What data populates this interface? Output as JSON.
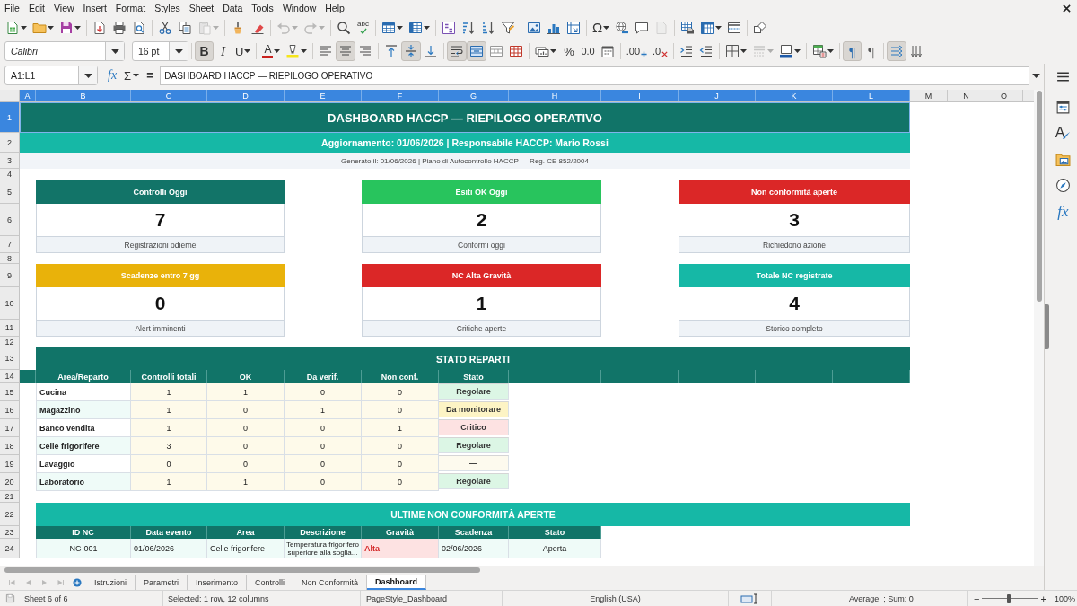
{
  "menu": [
    "File",
    "Edit",
    "View",
    "Insert",
    "Format",
    "Styles",
    "Sheet",
    "Data",
    "Tools",
    "Window",
    "Help"
  ],
  "standard_toolbar": [
    [
      {
        "kind": "new",
        "on": false,
        "disabled": false,
        "dropdown": true
      },
      {
        "kind": "open",
        "on": false,
        "disabled": false,
        "dropdown": true
      },
      {
        "kind": "save",
        "on": false,
        "disabled": false,
        "dropdown": true
      }
    ],
    [
      {
        "kind": "export-pdf",
        "on": false,
        "disabled": false
      },
      {
        "kind": "print",
        "on": false,
        "disabled": false
      },
      {
        "kind": "print-preview",
        "on": false,
        "disabled": false
      }
    ],
    [
      {
        "kind": "cut",
        "on": false,
        "disabled": false
      },
      {
        "kind": "copy",
        "on": false,
        "disabled": false
      },
      {
        "kind": "paste",
        "on": false,
        "disabled": true,
        "dropdown": true
      }
    ],
    [
      {
        "kind": "clone-format",
        "on": false,
        "disabled": false
      },
      {
        "kind": "clear-format",
        "on": false,
        "disabled": false
      }
    ],
    [
      {
        "kind": "undo",
        "on": false,
        "disabled": true,
        "dropdown": true
      },
      {
        "kind": "redo",
        "on": false,
        "disabled": true,
        "dropdown": true
      }
    ],
    [
      {
        "kind": "find-replace",
        "on": false,
        "disabled": false
      },
      {
        "kind": "spelling",
        "label": "abc",
        "on": false,
        "disabled": false
      }
    ],
    [
      {
        "kind": "insert-rows",
        "on": false,
        "disabled": false,
        "dropdown": true
      },
      {
        "kind": "insert-columns",
        "on": false,
        "disabled": false,
        "dropdown": true
      }
    ],
    [
      {
        "kind": "sort",
        "on": false,
        "disabled": false
      },
      {
        "kind": "sort-ascending",
        "on": false,
        "disabled": false
      },
      {
        "kind": "sort-descending",
        "on": false,
        "disabled": false
      },
      {
        "kind": "autofilter",
        "on": false,
        "disabled": false
      }
    ],
    [
      {
        "kind": "image",
        "on": false,
        "disabled": false
      },
      {
        "kind": "chart",
        "on": false,
        "disabled": false
      },
      {
        "kind": "pivot-table",
        "on": false,
        "disabled": false
      }
    ],
    [
      {
        "kind": "special-character",
        "label": "Ω",
        "on": false,
        "disabled": false,
        "dropdown": true
      },
      {
        "kind": "hyperlink",
        "on": false,
        "disabled": false
      },
      {
        "kind": "comment",
        "on": false,
        "disabled": false
      },
      {
        "kind": "header-footer",
        "on": false,
        "disabled": true
      }
    ],
    [
      {
        "kind": "print-range",
        "on": false,
        "disabled": false
      },
      {
        "kind": "freeze",
        "on": false,
        "disabled": false,
        "dropdown": true
      },
      {
        "kind": "split-window",
        "on": false,
        "disabled": false
      }
    ],
    [
      {
        "kind": "shapes",
        "on": false,
        "disabled": false
      }
    ]
  ],
  "formatting_toolbar": {
    "font_name": "Calibri",
    "font_size": "16 pt",
    "groups": [
      [
        {
          "kind": "bold",
          "label": "B",
          "on": true,
          "disabled": false
        },
        {
          "kind": "italic",
          "label": "I",
          "on": false,
          "disabled": false
        },
        {
          "kind": "underline",
          "label": "U",
          "on": false,
          "disabled": false,
          "dropdown": true
        }
      ],
      [
        {
          "kind": "font-color",
          "label": "A",
          "on": false,
          "disabled": false,
          "dropdown": true
        },
        {
          "kind": "highlight",
          "on": false,
          "disabled": false,
          "dropdown": true
        }
      ],
      [
        {
          "kind": "align-left",
          "on": false,
          "disabled": false
        },
        {
          "kind": "align-center",
          "on": true,
          "disabled": false
        },
        {
          "kind": "align-right",
          "on": false,
          "disabled": false
        }
      ],
      [
        {
          "kind": "align-top",
          "on": false,
          "disabled": false
        },
        {
          "kind": "align-middle",
          "on": true,
          "disabled": false
        },
        {
          "kind": "align-bottom",
          "on": false,
          "disabled": false
        }
      ],
      [
        {
          "kind": "wrap-text",
          "on": true,
          "disabled": false
        },
        {
          "kind": "merge-center",
          "on": true,
          "disabled": false
        },
        {
          "kind": "merge-cells",
          "on": false,
          "disabled": false
        },
        {
          "kind": "unmerge-cells",
          "on": false,
          "disabled": false
        }
      ],
      [
        {
          "kind": "currency",
          "on": false,
          "disabled": false,
          "dropdown": true
        },
        {
          "kind": "percent",
          "label": "%",
          "on": false,
          "disabled": false
        },
        {
          "kind": "number-standard",
          "label": "0.0",
          "on": false,
          "disabled": false
        },
        {
          "kind": "date",
          "on": false,
          "disabled": false
        }
      ],
      [
        {
          "kind": "add-decimal",
          "label": ".00",
          "on": false,
          "disabled": false
        },
        {
          "kind": "delete-decimal",
          "label": ".0",
          "on": false,
          "disabled": false
        }
      ],
      [
        {
          "kind": "indent",
          "on": false,
          "disabled": false
        },
        {
          "kind": "outdent",
          "on": false,
          "disabled": false
        }
      ],
      [
        {
          "kind": "borders",
          "on": false,
          "disabled": false,
          "dropdown": true
        },
        {
          "kind": "border-style",
          "on": false,
          "disabled": true,
          "dropdown": true
        },
        {
          "kind": "border-color",
          "on": false,
          "disabled": false,
          "dropdown": true
        }
      ],
      [
        {
          "kind": "conditional",
          "on": false,
          "disabled": false,
          "dropdown": true
        }
      ],
      [
        {
          "kind": "para-ltr",
          "label": "¶",
          "on": true,
          "disabled": false
        },
        {
          "kind": "para-rtl",
          "label": "¶",
          "on": false,
          "disabled": false
        }
      ],
      [
        {
          "kind": "text-ltr",
          "on": true,
          "disabled": false
        },
        {
          "kind": "vertical-text",
          "on": false,
          "disabled": false
        }
      ]
    ]
  },
  "formula_bar": {
    "name_box": "A1:L1",
    "buttons": [
      {
        "kind": "function-wizard",
        "label": "fx"
      },
      {
        "kind": "sum",
        "label": "Σ",
        "dropdown": true
      },
      {
        "kind": "formula",
        "label": "="
      }
    ],
    "content": "DASHBOARD HACCP — RIEPILOGO OPERATIVO"
  },
  "sidebar": [
    {
      "kind": "properties"
    },
    {
      "kind": "styles",
      "label": "A"
    },
    {
      "kind": "gallery"
    },
    {
      "kind": "navigator"
    },
    {
      "kind": "functions",
      "label": "fx"
    }
  ],
  "sheet": {
    "columns": [
      {
        "label": "A",
        "selected": true
      },
      {
        "label": "B",
        "selected": true
      },
      {
        "label": "C",
        "selected": true
      },
      {
        "label": "D",
        "selected": true
      },
      {
        "label": "E",
        "selected": true
      },
      {
        "label": "F",
        "selected": true
      },
      {
        "label": "G",
        "selected": true
      },
      {
        "label": "H",
        "selected": true
      },
      {
        "label": "I",
        "selected": true
      },
      {
        "label": "J",
        "selected": true
      },
      {
        "label": "K",
        "selected": true
      },
      {
        "label": "L",
        "selected": true
      },
      {
        "label": "M",
        "selected": false
      },
      {
        "label": "N",
        "selected": false
      },
      {
        "label": "O",
        "selected": false
      }
    ],
    "rows": [
      {
        "label": "1",
        "selected": true
      },
      {
        "label": "2",
        "selected": false
      },
      {
        "label": "3",
        "selected": false
      },
      {
        "label": "4",
        "selected": false
      },
      {
        "label": "5",
        "selected": false
      },
      {
        "label": "6",
        "selected": false
      },
      {
        "label": "7",
        "selected": false
      },
      {
        "label": "8",
        "selected": false
      },
      {
        "label": "9",
        "selected": false
      },
      {
        "label": "10",
        "selected": false
      },
      {
        "label": "11",
        "selected": false
      },
      {
        "label": "12",
        "selected": false
      },
      {
        "label": "13",
        "selected": false
      },
      {
        "label": "14",
        "selected": false
      },
      {
        "label": "15",
        "selected": false
      },
      {
        "label": "16",
        "selected": false
      },
      {
        "label": "17",
        "selected": false
      },
      {
        "label": "18",
        "selected": false
      },
      {
        "label": "19",
        "selected": false
      },
      {
        "label": "20",
        "selected": false
      },
      {
        "label": "21",
        "selected": false
      },
      {
        "label": "22",
        "selected": false
      },
      {
        "label": "23",
        "selected": false
      },
      {
        "label": "24",
        "selected": false
      }
    ],
    "title": {
      "text": "DASHBOARD HACCP — RIEPILOGO OPERATIVO",
      "selected": true
    },
    "subtitle": "Aggiornamento: 01/06/2026 | Responsabile HACCP: Mario Rossi",
    "generated_note": "Generato il: 01/06/2026 | Piano di Autocontrollo HACCP — Reg. CE 852/2004",
    "kpi_cards": [
      {
        "title": "Controlli Oggi",
        "value": "7",
        "caption": "Registrazioni odierne",
        "color": "#127468"
      },
      {
        "title": "Esiti OK Oggi",
        "value": "2",
        "caption": "Conformi oggi",
        "color": "#28c45d"
      },
      {
        "title": "Non conformità aperte",
        "value": "3",
        "caption": "Richiedono azione",
        "color": "#db2727"
      },
      {
        "title": "Scadenze entro 7 gg",
        "value": "0",
        "caption": "Alert imminenti",
        "color": "#e9b20a"
      },
      {
        "title": "NC Alta Gravità",
        "value": "1",
        "caption": "Critiche aperte",
        "color": "#db2727"
      },
      {
        "title": "Totale NC registrate",
        "value": "4",
        "caption": "Storico completo",
        "color": "#16b8a6"
      }
    ],
    "departments": {
      "title": "STATO REPARTI",
      "columns": [
        "Area/Reparto",
        "Controlli totali",
        "OK",
        "Da verif.",
        "Non conf.",
        "Stato"
      ],
      "rows": [
        {
          "kind": "ok",
          "area": "Cucina",
          "values": [
            "1",
            "1",
            "0",
            "0"
          ],
          "status": "Regolare"
        },
        {
          "kind": "warn",
          "area": "Magazzino",
          "values": [
            "1",
            "0",
            "1",
            "0"
          ],
          "status": "Da monitorare"
        },
        {
          "kind": "critical",
          "area": "Banco vendita",
          "values": [
            "1",
            "0",
            "0",
            "1"
          ],
          "status": "Critico"
        },
        {
          "kind": "ok",
          "area": "Celle frigorifere",
          "values": [
            "3",
            "0",
            "0",
            "0"
          ],
          "status": "Regolare"
        },
        {
          "kind": "none",
          "area": "Lavaggio",
          "values": [
            "0",
            "0",
            "0",
            "0"
          ],
          "status": "—"
        },
        {
          "kind": "ok",
          "area": "Laboratorio",
          "values": [
            "1",
            "1",
            "0",
            "0"
          ],
          "status": "Regolare"
        }
      ]
    },
    "nonconformities": {
      "title": "ULTIME NON CONFORMITÀ APERTE",
      "columns": [
        "ID NC",
        "Data evento",
        "Area",
        "Descrizione",
        "Gravità",
        "Scadenza",
        "Stato"
      ],
      "rows": [
        {
          "kind": "high",
          "id": "NC-001",
          "date": "01/06/2026",
          "area": "Celle frigorifere",
          "description": "Temperatura frigorifero superiore alla soglia...",
          "severity": "Alta",
          "due": "02/06/2026",
          "status": "Aperta"
        }
      ]
    }
  },
  "sheet_tabs": {
    "nav": [
      {
        "kind": "first",
        "disabled": true
      },
      {
        "kind": "previous",
        "disabled": true
      },
      {
        "kind": "next",
        "disabled": true
      },
      {
        "kind": "last",
        "disabled": true
      }
    ],
    "tabs": [
      {
        "label": "Istruzioni",
        "selected": false
      },
      {
        "label": "Parametri",
        "selected": false
      },
      {
        "label": "Inserimento",
        "selected": false
      },
      {
        "label": "Controlli",
        "selected": false
      },
      {
        "label": "Non Conformità",
        "selected": false
      },
      {
        "label": "Dashboard",
        "selected": true
      }
    ]
  },
  "status_bar": {
    "sheet": "Sheet 6 of 6",
    "selection": "Selected: 1 row, 12 columns",
    "page_style": "PageStyle_Dashboard",
    "language": "English (USA)",
    "summary": "Average: ; Sum: 0",
    "zoom_out": "−",
    "zoom_slider": {
      "level": 0.5
    },
    "zoom_in": "+",
    "zoom": "100%"
  }
}
